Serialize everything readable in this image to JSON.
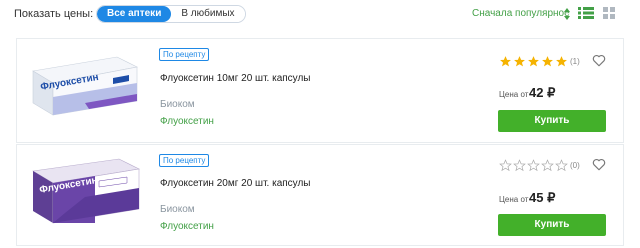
{
  "toolbar": {
    "show_prices_label": "Показать цены:",
    "filter_all": "Все аптеки",
    "filter_favorites": "В любимых",
    "sort_label": "Сначала популярное",
    "sort_icon": "sort-arrows-icon",
    "view_list_icon": "list-view-icon",
    "view_grid_icon": "grid-view-icon"
  },
  "colors": {
    "accent_blue": "#1e88e5",
    "accent_green": "#43a047",
    "button_green": "#43b02a",
    "star_gold": "#f5b301"
  },
  "products": [
    {
      "badge": "По рецепту",
      "name": "Флуоксетин 10мг 20 шт. капсулы",
      "manufacturer": "Биоком",
      "substance": "Флуоксетин",
      "rating": 5,
      "rating_count": "(1)",
      "price_label": "Цена от",
      "price": "42 ₽",
      "buy_label": "Купить",
      "box_brand": "Флуоксетин"
    },
    {
      "badge": "По рецепту",
      "name": "Флуоксетин 20мг 20 шт. капсулы",
      "manufacturer": "Биоком",
      "substance": "Флуоксетин",
      "rating": 0,
      "rating_count": "(0)",
      "price_label": "Цена от",
      "price": "45 ₽",
      "buy_label": "Купить",
      "box_brand": "Флуоксетин"
    }
  ]
}
